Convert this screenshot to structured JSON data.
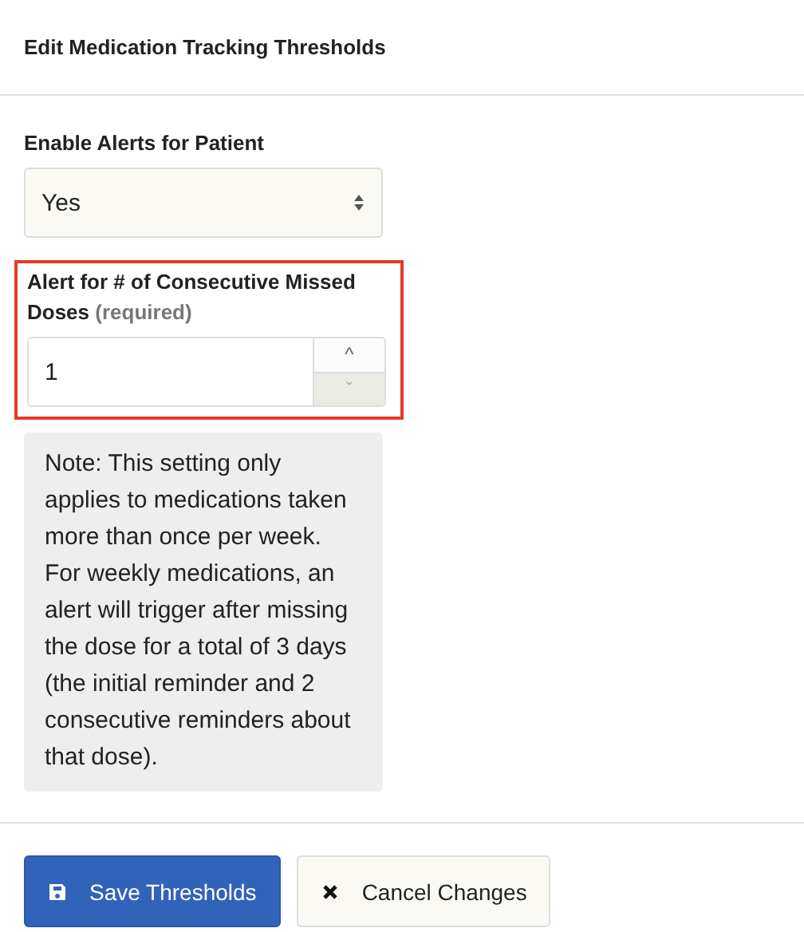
{
  "header": {
    "title": "Edit Medication Tracking Thresholds"
  },
  "enable_alerts": {
    "label": "Enable Alerts for Patient",
    "value": "Yes"
  },
  "missed_doses": {
    "label": "Alert for # of Consecutive Missed Doses",
    "hint": "(required)",
    "value": "1",
    "highlighted": true,
    "down_disabled": true,
    "up_icon": "^",
    "down_icon": "ˇ"
  },
  "note": "Note: This setting only applies to medications taken more than once per week. For weekly medications, an alert will trigger after missing the dose for a total of 3 days (the initial reminder and 2 consecutive reminders about that dose).",
  "buttons": [
    {
      "kind": "primary",
      "label": "Save Thresholds"
    },
    {
      "kind": "cancel",
      "label": "Cancel Changes"
    }
  ]
}
